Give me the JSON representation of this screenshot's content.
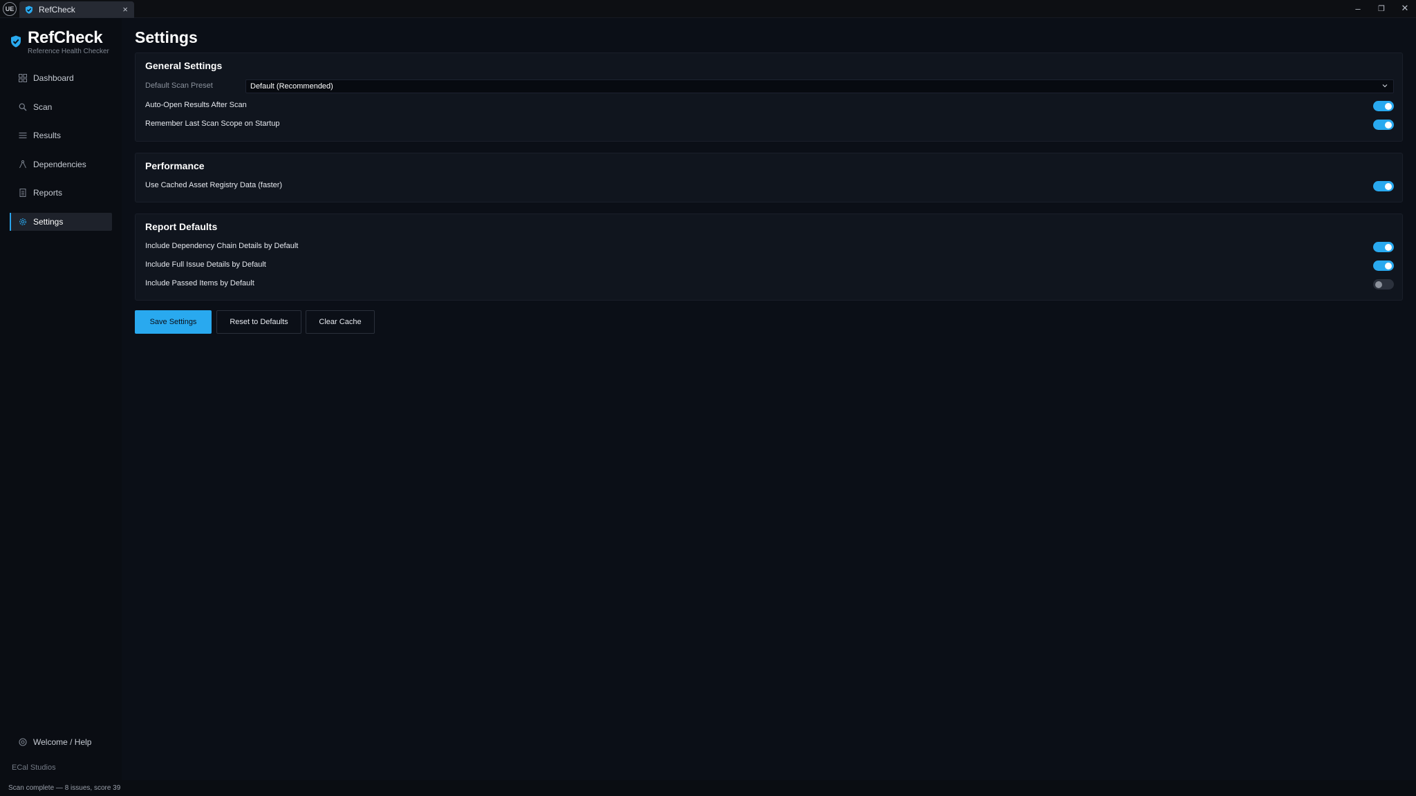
{
  "titlebar": {
    "logo_text": "UE",
    "tab_label": "RefCheck",
    "tab_close": "×",
    "minimize": "–",
    "restore": "❐",
    "close": "✕"
  },
  "sidebar": {
    "brand_name": "RefCheck",
    "brand_sub": "Reference Health Checker",
    "items": [
      {
        "label": "Dashboard",
        "icon": "grid-icon"
      },
      {
        "label": "Scan",
        "icon": "search-icon"
      },
      {
        "label": "Results",
        "icon": "list-icon"
      },
      {
        "label": "Dependencies",
        "icon": "tree-icon"
      },
      {
        "label": "Reports",
        "icon": "document-icon"
      },
      {
        "label": "Settings",
        "icon": "gear-icon",
        "active": true
      }
    ],
    "help_label": "Welcome / Help",
    "studio": "ECal Studios"
  },
  "main": {
    "title": "Settings",
    "general": {
      "title": "General Settings",
      "preset_label": "Default Scan Preset",
      "preset_value": "Default (Recommended)",
      "auto_open_label": "Auto-Open Results After Scan",
      "auto_open_on": true,
      "remember_label": "Remember Last Scan Scope on Startup",
      "remember_on": true
    },
    "performance": {
      "title": "Performance",
      "cached_label": "Use Cached Asset Registry Data (faster)",
      "cached_on": true
    },
    "reports": {
      "title": "Report Defaults",
      "chain_label": "Include Dependency Chain Details by Default",
      "chain_on": true,
      "issues_label": "Include Full Issue Details by Default",
      "issues_on": true,
      "passed_label": "Include Passed Items by Default",
      "passed_on": false
    },
    "buttons": {
      "save": "Save Settings",
      "reset": "Reset to Defaults",
      "clear": "Clear Cache"
    }
  },
  "statusbar": {
    "text": "Scan complete — 8 issues, score 39"
  },
  "colors": {
    "accent": "#29a9ef",
    "background": "#0b0f17",
    "card": "#10151e"
  }
}
